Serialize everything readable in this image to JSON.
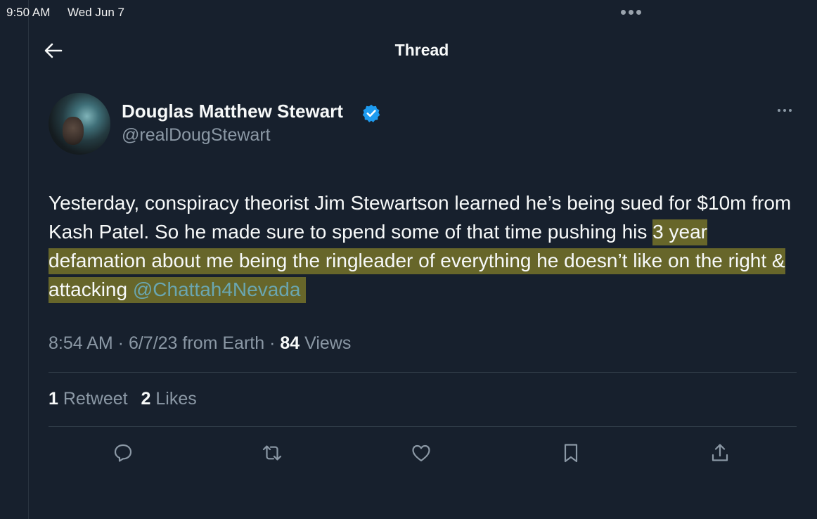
{
  "status_bar": {
    "time": "9:50 AM",
    "date": "Wed Jun 7"
  },
  "header": {
    "title": "Thread",
    "back_icon": "arrow-left-icon"
  },
  "author": {
    "name": "Douglas Matthew Stewart",
    "handle": "@realDougStewart",
    "verified": true,
    "verified_color": "#1d9bf0"
  },
  "tweet": {
    "text_plain_1": "Yesterday, conspiracy theorist Jim Stewartson learned he’s being sued for $10m from Kash Patel. So he made sure to spend some of that time pushing his",
    "text_highlight": "3 year defamation about me being the ringleader of everything he doesn’t like on the right & attacking",
    "mention": "@Chattah4Nevada",
    "highlight_color": "#aaa028"
  },
  "meta": {
    "time": "8:54 AM",
    "date": "6/7/23",
    "source": "from Earth",
    "views_count": "84",
    "views_label": "Views"
  },
  "stats": {
    "retweets_count": "1",
    "retweets_label": "Retweet",
    "likes_count": "2",
    "likes_label": "Likes"
  },
  "actions": [
    "reply-icon",
    "retweet-icon",
    "like-icon",
    "bookmark-icon",
    "share-icon"
  ],
  "colors": {
    "background": "#17202d",
    "text_primary": "#f7f9f9",
    "text_secondary": "#8b98a5",
    "link": "#6aa6b0"
  }
}
